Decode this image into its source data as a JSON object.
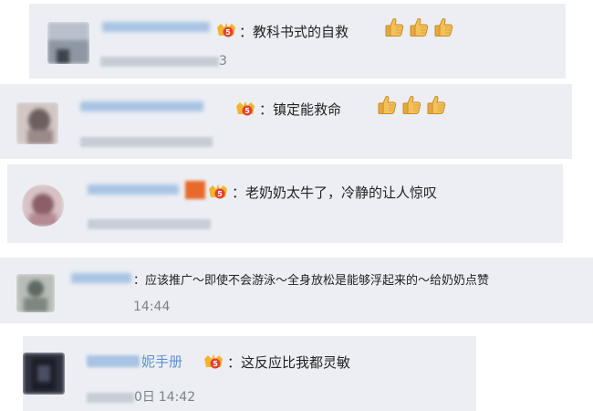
{
  "comments": [
    {
      "text": "：教科书式的自救",
      "time_suffix": "3",
      "thumbs": 3
    },
    {
      "text": "：镇定能救命",
      "thumbs": 3
    },
    {
      "text": "：老奶奶太牛了，冷静的让人惊叹",
      "thumbs": 0
    },
    {
      "text": "：应该推广～即使不会游泳～全身放松是能够浮起来的～给奶奶点赞",
      "time": "14:44",
      "thumbs": 0
    },
    {
      "name_visible": "妮手册",
      "text": "：这反应比我都灵敏",
      "time_day": "0日",
      "time": "14:42",
      "thumbs": 0
    }
  ],
  "icons": {
    "badge": "vip-crown-icon",
    "thumb": "thumbs-up-icon"
  },
  "colors": {
    "card_bg": "#eceef3",
    "name": "#5e8fd0",
    "badge_red": "#e5402f",
    "badge_gold": "#f3b431",
    "thumb": "#f1b64c"
  }
}
